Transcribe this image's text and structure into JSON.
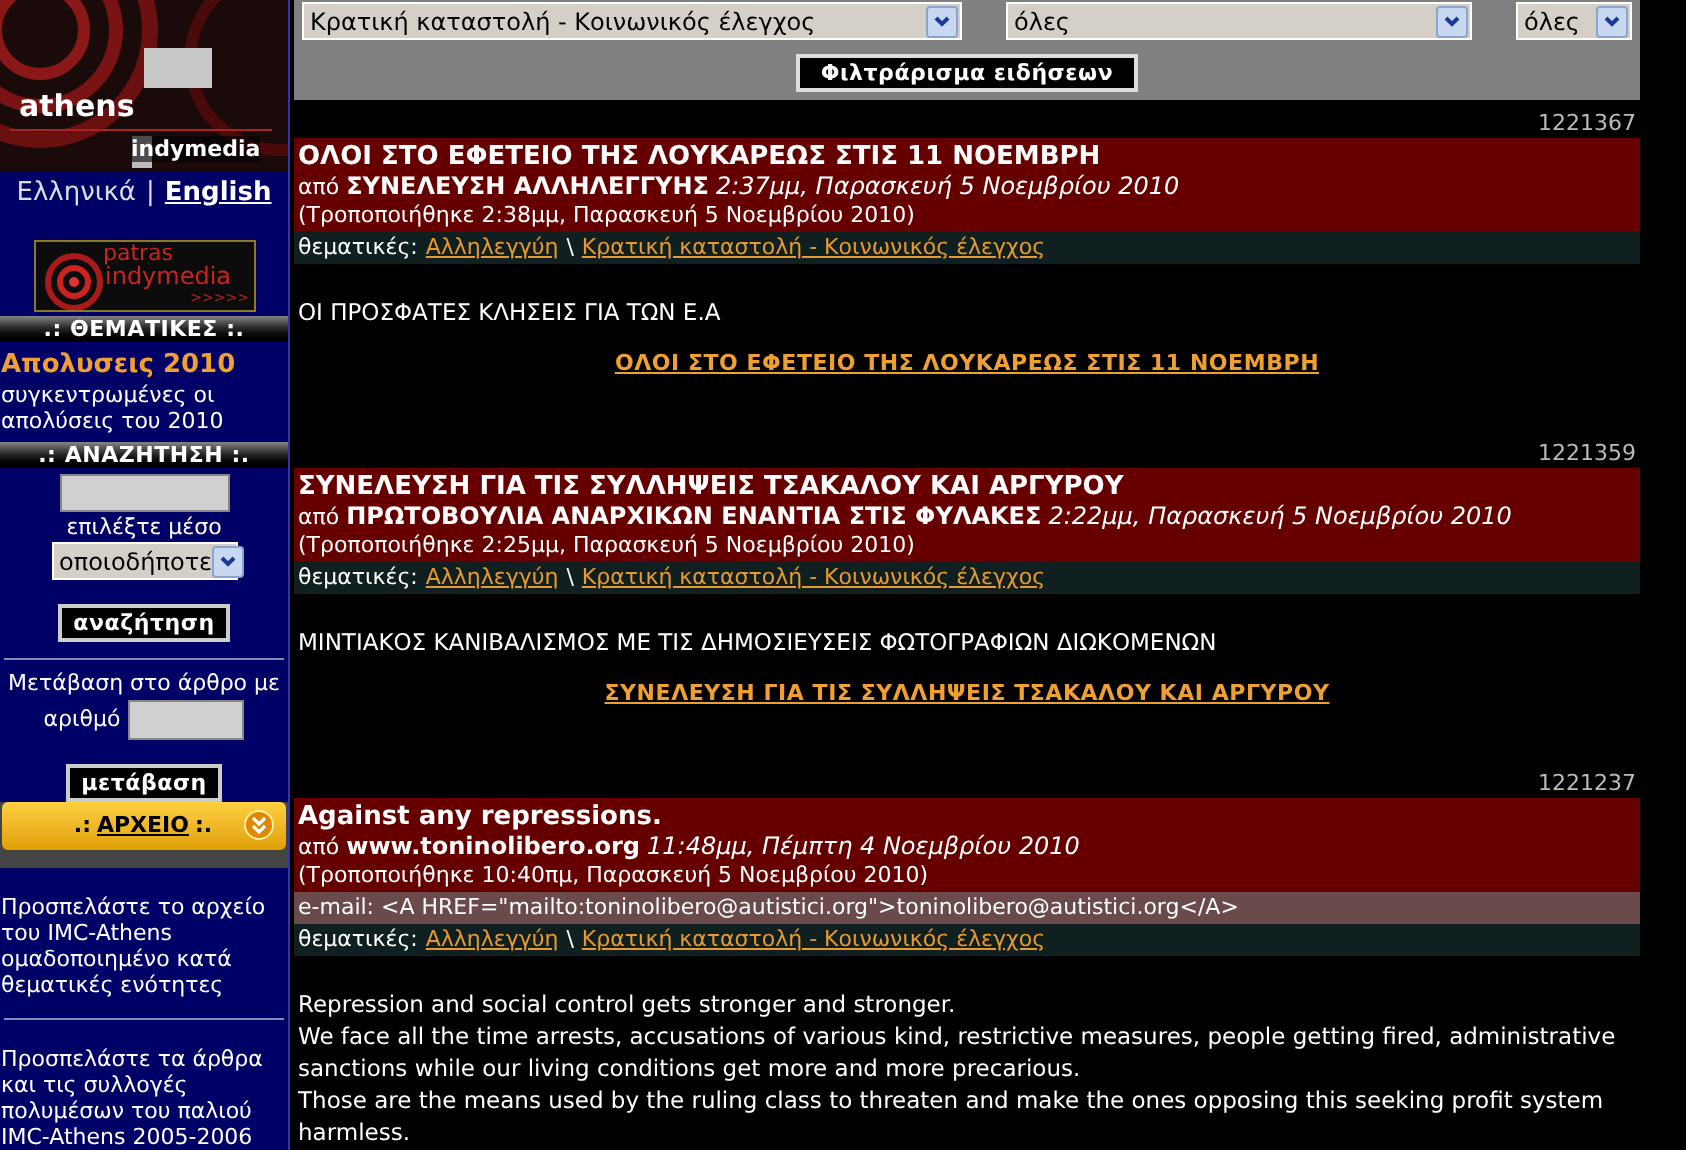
{
  "sidebar": {
    "logo": {
      "line1": "athens",
      "line2": "indymedia"
    },
    "languages": [
      {
        "label": "Ελληνικά",
        "selected": false
      },
      {
        "label": "English",
        "selected": true
      }
    ],
    "language_separator": "|",
    "banner": {
      "line1": "patras",
      "line2": "indymedia",
      "arrows": ">>>>>"
    },
    "topics_header": ".: ΘΕΜΑΤΙΚΕΣ :.",
    "feature": {
      "title": "Απολυσεις 2010",
      "text": "συγκεντρωμένες οι απολύσεις του 2010"
    },
    "search_header": ".: ΑΝΑΖΗΤΗΣΗ :.",
    "media_label": "επιλέξτε μέσο",
    "media_select": "οποιοδήποτε",
    "search_button": "αναζήτηση",
    "goto_label": "Μετάβαση στο άρθρο με",
    "goto_label_2": "αριθμό",
    "goto_button": "μετάβαση",
    "archive": {
      "prefix": ".:",
      "link": "ΑΡΧΕΙΟ",
      "suffix": ":."
    },
    "archive_texts": [
      "Προσπελάστε το αρχείο του IMC-Athens ομαδοποιημένο κατά θεματικές ενότητες",
      "Προσπελάστε τα άρθρα και τις συλλογές πολυμέσων του παλιού IMC-Athens 2005-2006"
    ]
  },
  "filters": {
    "selects": [
      {
        "value": "Κρατική καταστολή - Κοινωνικός έλεγχος"
      },
      {
        "value": "όλες"
      },
      {
        "value": "όλες"
      }
    ],
    "button": "Φιλτράρισμα ειδήσεων"
  },
  "articles": [
    {
      "id": "1221367",
      "title": "ΟΛΟΙ ΣΤΟ ΕΦΕΤΕΙΟ ΤΗΣ ΛΟΥΚΑΡΕΩΣ ΣΤΙΣ 11 ΝΟΕΜΒΡΗ",
      "by": "από",
      "author": "ΣΥΝΕΛΕΥΣΗ ΑΛΛΗΛΕΓΓΥΗΣ",
      "time": "2:37μμ, Παρασκευή 5 Νοεμβρίου 2010",
      "modified": "(Τροποποιήθηκε 2:38μμ, Παρασκευή 5 Νοεμβρίου 2010)",
      "topics_label": "θεματικές:",
      "topics": [
        "Αλληλεγγύη",
        "Κρατική καταστολή - Κοινωνικός έλεγχος"
      ],
      "topic_separator": "\\",
      "body": [
        "ΟΙ ΠΡΟΣΦΑΤΕΣ ΚΛΗΣΕΙΣ ΓΙΑ ΤΩΝ Ε.Α"
      ],
      "link": "ΟΛΟΙ ΣΤΟ ΕΦΕΤΕΙΟ ΤΗΣ ΛΟΥΚΑΡΕΩΣ ΣΤΙΣ 11 ΝΟΕΜΒΡΗ"
    },
    {
      "id": "1221359",
      "title": "ΣΥΝΕΛΕΥΣΗ ΓΙΑ ΤΙΣ ΣΥΛΛΗΨΕΙΣ ΤΣΑΚΑΛΟΥ ΚΑΙ ΑΡΓΥΡΟΥ",
      "by": "από",
      "author": "ΠΡΩΤΟΒΟΥΛΙΑ ΑΝΑΡΧΙΚΩΝ ΕΝΑΝΤΙΑ ΣΤΙΣ ΦΥΛΑΚΕΣ",
      "time": "2:22μμ, Παρασκευή 5 Νοεμβρίου 2010",
      "modified": "(Τροποποιήθηκε 2:25μμ, Παρασκευή 5 Νοεμβρίου 2010)",
      "topics_label": "θεματικές:",
      "topics": [
        "Αλληλεγγύη",
        "Κρατική καταστολή - Κοινωνικός έλεγχος"
      ],
      "topic_separator": "\\",
      "body": [
        "ΜΙΝΤΙΑΚΟΣ ΚΑΝΙΒΑΛΙΣΜΟΣ ΜΕ ΤΙΣ ΔΗΜΟΣΙΕΥΣΕΙΣ ΦΩΤΟΓΡΑΦΙΩΝ ΔΙΩΚΟΜΕΝΩΝ"
      ],
      "link": "ΣΥΝΕΛΕΥΣΗ ΓΙΑ ΤΙΣ ΣΥΛΛΗΨΕΙΣ ΤΣΑΚΑΛΟΥ ΚΑΙ ΑΡΓΥΡΟΥ"
    },
    {
      "id": "1221237",
      "title": "Against any repressions.",
      "by": "από",
      "author": "www.toninolibero.org",
      "time": "11:48μμ, Πέμπτη 4 Νοεμβρίου 2010",
      "modified": "(Τροποποιήθηκε 10:40πμ, Παρασκευή 5 Νοεμβρίου 2010)",
      "email": "e-mail: <A HREF=\"mailto:toninolibero@autistici.org\">toninolibero@autistici.org</A>",
      "topics_label": "θεματικές:",
      "topics": [
        "Αλληλεγγύη",
        "Κρατική καταστολή - Κοινωνικός έλεγχος"
      ],
      "topic_separator": "\\",
      "body": [
        "Repression and social control gets stronger and stronger.",
        "We face all the time arrests, accusations of various kind, restrictive measures, people getting fired, administrative sanctions while our living conditions get more and more precarious.",
        "Those are the means used by the ruling class to threaten and make the ones opposing this seeking profit system harmless."
      ]
    }
  ]
}
